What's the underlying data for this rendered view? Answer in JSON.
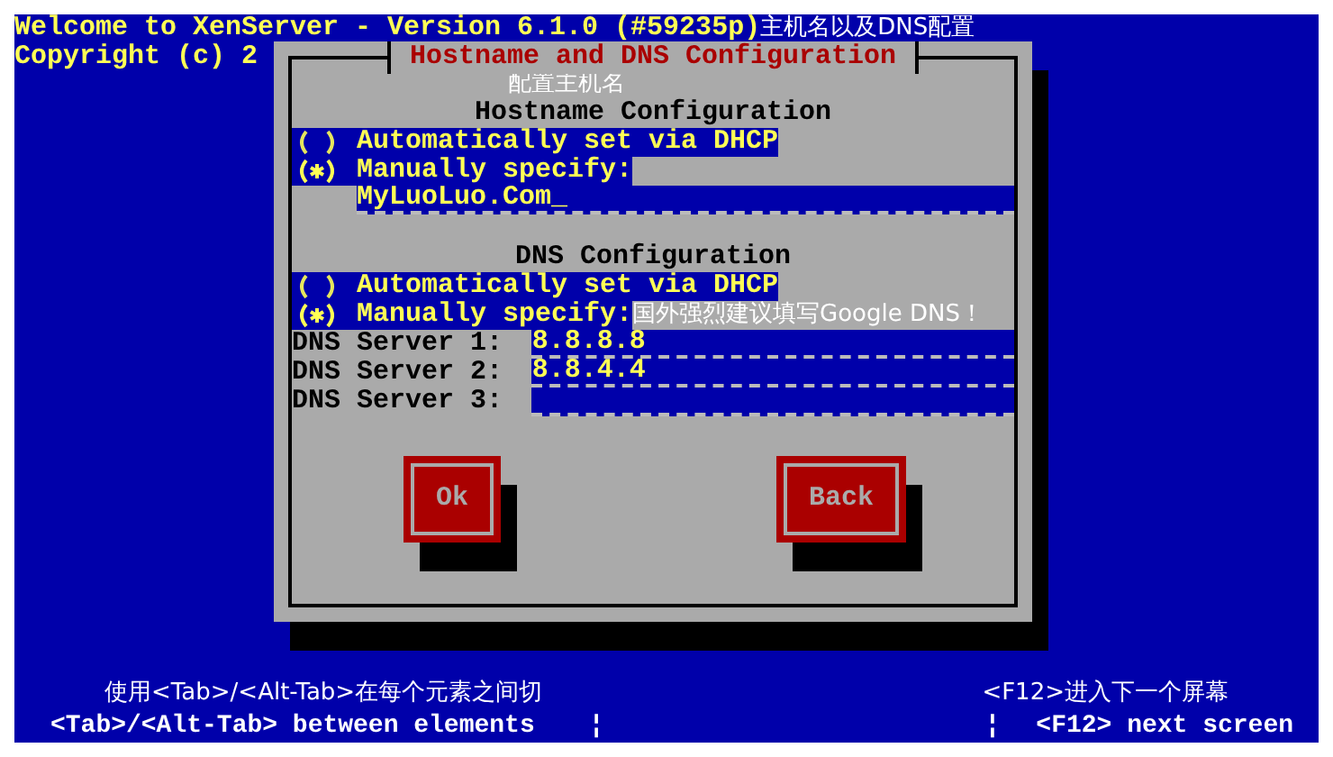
{
  "header": {
    "title": "Welcome to XenServer - Version 6.1.0 (#59235p)",
    "annotation": "主机名以及DNS配置",
    "copyright": "Copyright (c) 2"
  },
  "dialog": {
    "title": "Hostname and DNS Configuration",
    "hostname": {
      "annotation": "配置主机名",
      "heading": "Hostname Configuration",
      "options": [
        {
          "label": "Automatically set via DHCP",
          "selected": false
        },
        {
          "label": "Manually specify:",
          "selected": true
        }
      ],
      "value": "MyLuoLuo.Com",
      "cursor": "_"
    },
    "dns": {
      "heading": "DNS Configuration",
      "options": [
        {
          "label": "Automatically set via DHCP",
          "selected": false
        },
        {
          "label": "Manually specify:",
          "selected": true
        }
      ],
      "annotation": "国外强烈建议填写Google DNS！",
      "servers": [
        {
          "label": "DNS Server 1:",
          "value": "8.8.8.8"
        },
        {
          "label": "DNS Server 2:",
          "value": "8.8.4.4"
        },
        {
          "label": "DNS Server 3:"
        }
      ]
    },
    "buttons": [
      "Ok",
      "Back"
    ]
  },
  "footer": {
    "annotation_left": "使用<Tab>/<Alt-Tab>在每个元素之间切",
    "annotation_right": "<F12>进入下一个屏幕",
    "help_left": "<Tab>/<Alt-Tab> between elements",
    "separator_1": "¦",
    "separator_2": "¦",
    "help_right": "<F12> next screen"
  }
}
